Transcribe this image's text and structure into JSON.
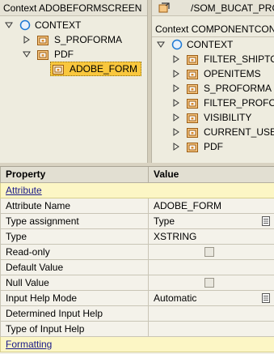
{
  "left_pane": {
    "header": "Context ADOBEFORMSCREEN",
    "tree": [
      {
        "label": "CONTEXT",
        "type": "context",
        "toggle": "expanded"
      },
      {
        "label": "S_PROFORMA",
        "type": "node",
        "toggle": "collapsed"
      },
      {
        "label": "PDF",
        "type": "node",
        "toggle": "expanded"
      },
      {
        "label": "ADOBE_FORM",
        "type": "node",
        "toggle": "none",
        "selected": true
      }
    ]
  },
  "right_pane": {
    "path": "/SOM_BUCAT_PROV",
    "header": "Context COMPONENTCONTROLLER",
    "tree": [
      {
        "label": "CONTEXT",
        "type": "context",
        "toggle": "expanded"
      },
      {
        "label": "FILTER_SHIPTO",
        "type": "node",
        "toggle": "collapsed"
      },
      {
        "label": "OPENITEMS",
        "type": "node",
        "toggle": "collapsed"
      },
      {
        "label": "S_PROFORMA",
        "type": "node",
        "toggle": "collapsed"
      },
      {
        "label": "FILTER_PROFORMA",
        "type": "node",
        "toggle": "collapsed"
      },
      {
        "label": "VISIBILITY",
        "type": "node",
        "toggle": "collapsed"
      },
      {
        "label": "CURRENT_USER",
        "type": "node",
        "toggle": "collapsed"
      },
      {
        "label": "PDF",
        "type": "node",
        "toggle": "collapsed"
      }
    ]
  },
  "properties": {
    "col_property": "Property",
    "col_value": "Value",
    "group_attribute": "Attribute",
    "group_formatting": "Formatting",
    "rows": [
      {
        "name": "Attribute Name",
        "value": "ADOBE_FORM",
        "kind": "text"
      },
      {
        "name": "Type assignment",
        "value": "Type",
        "kind": "dropdown"
      },
      {
        "name": "Type",
        "value": "XSTRING",
        "kind": "text"
      },
      {
        "name": "Read-only",
        "value": "",
        "kind": "checkbox",
        "checked": false
      },
      {
        "name": "Default Value",
        "value": "",
        "kind": "text"
      },
      {
        "name": "Null Value",
        "value": "",
        "kind": "checkbox",
        "checked": false
      },
      {
        "name": "Input Help Mode",
        "value": "Automatic",
        "kind": "dropdown"
      },
      {
        "name": "Determined Input Help",
        "value": "",
        "kind": "text"
      },
      {
        "name": "Type of Input Help",
        "value": "",
        "kind": "text"
      }
    ]
  },
  "colors": {
    "pane_bg": "#eeecdf",
    "selection": "#f9c73d",
    "group_row": "#fcf6c5",
    "context_icon": "#1c78d4",
    "node_icon": "#d9892a"
  }
}
